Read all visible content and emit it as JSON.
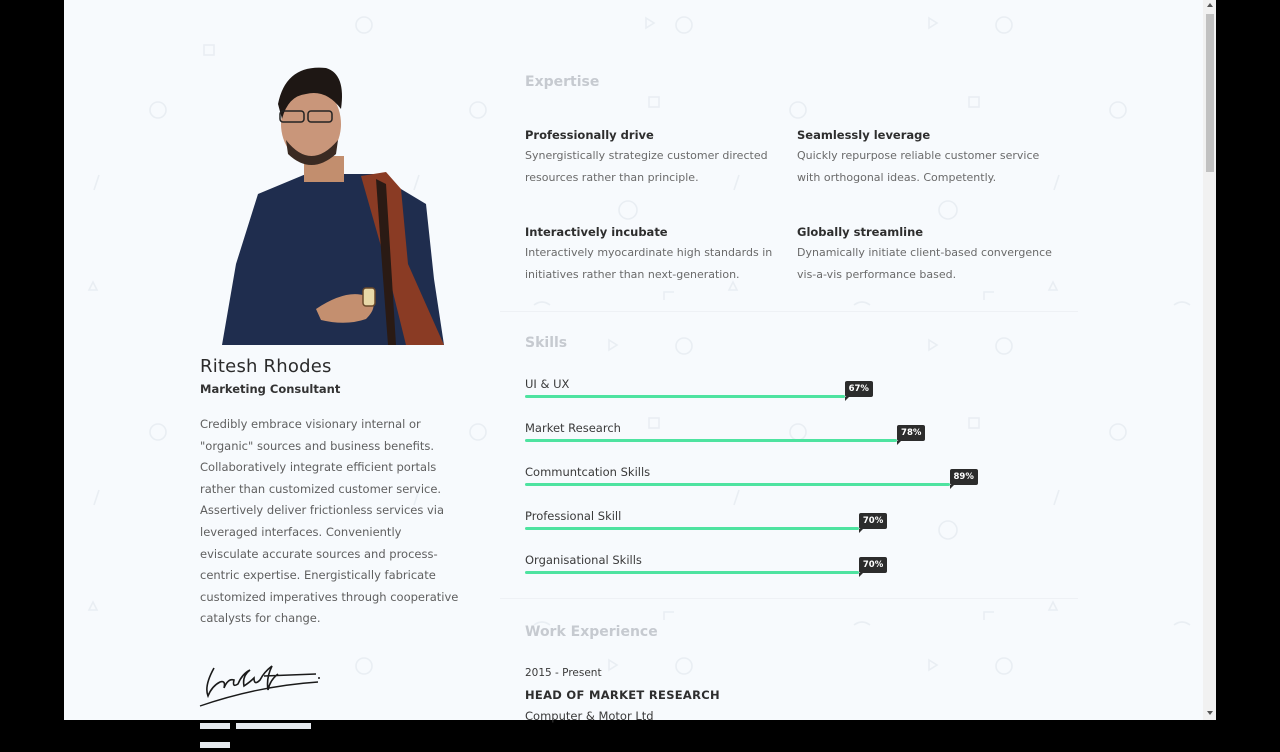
{
  "profile": {
    "name": "Ritesh Rhodes",
    "role": "Marketing Consultant",
    "bio": "Credibly embrace visionary internal or \"organic\" sources and business benefits. Collaboratively integrate efficient portals rather than customized customer service. Assertively deliver frictionless services via leveraged interfaces. Conveniently evisculate accurate sources and process-centric expertise. Energistically fabricate customized imperatives through cooperative catalysts for change.",
    "signature_text": "LaraCroft"
  },
  "expertise": {
    "title": "Expertise",
    "items": [
      {
        "title": "Professionally drive",
        "text": "Synergistically strategize customer directed resources rather than principle."
      },
      {
        "title": "Seamlessly leverage",
        "text": "Quickly repurpose reliable customer service with orthogonal ideas. Competently."
      },
      {
        "title": "Interactively incubate",
        "text": "Interactively myocardinate high standards in initiatives rather than next-generation."
      },
      {
        "title": "Globally streamline",
        "text": "Dynamically initiate client-based convergence vis-a-vis performance based."
      }
    ]
  },
  "skills": {
    "title": "Skills",
    "items": [
      {
        "label": "UI & UX",
        "percent": 67,
        "badge": "67%"
      },
      {
        "label": "Market Research",
        "percent": 78,
        "badge": "78%"
      },
      {
        "label": "Communtcation Skills",
        "percent": 89,
        "badge": "89%"
      },
      {
        "label": "Professional Skill",
        "percent": 70,
        "badge": "70%"
      },
      {
        "label": "Organisational Skills",
        "percent": 70,
        "badge": "70%"
      }
    ]
  },
  "work": {
    "title": "Work Experience",
    "items": [
      {
        "date": "2015 - Present",
        "title": "HEAD OF MARKET RESEARCH",
        "company": "Computer & Motor Ltd"
      }
    ]
  },
  "colors": {
    "accent": "#4ee3a0",
    "badge_bg": "#2c2c2c",
    "page_bg": "#f7fafd",
    "section_title": "#c6cad0"
  }
}
